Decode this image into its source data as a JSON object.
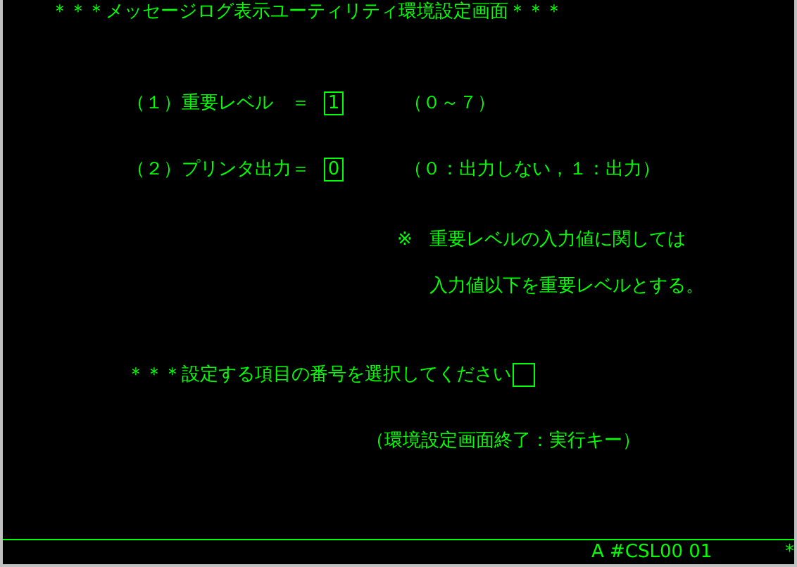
{
  "title": "＊＊＊メッセージログ表示ユーティリティ環境設定画面＊＊＊",
  "settings": [
    {
      "label": "（１）重要レベル　＝",
      "value": "1",
      "hint": "（０～７）"
    },
    {
      "label": "（２）プリンタ出力＝",
      "value": "0",
      "hint": "（０：出力しない，１：出力）"
    }
  ],
  "note": {
    "mark": "※",
    "lines": [
      "重要レベルの入力値に関しては",
      "入力値以下を重要レベルとする。"
    ]
  },
  "prompt": {
    "label": "＊＊＊設定する項目の番号を選択してください"
  },
  "exit_hint": "（環境設定画面終了：実行キー）",
  "status_bar": {
    "text": "A #CSL00 01",
    "mark": "*"
  }
}
